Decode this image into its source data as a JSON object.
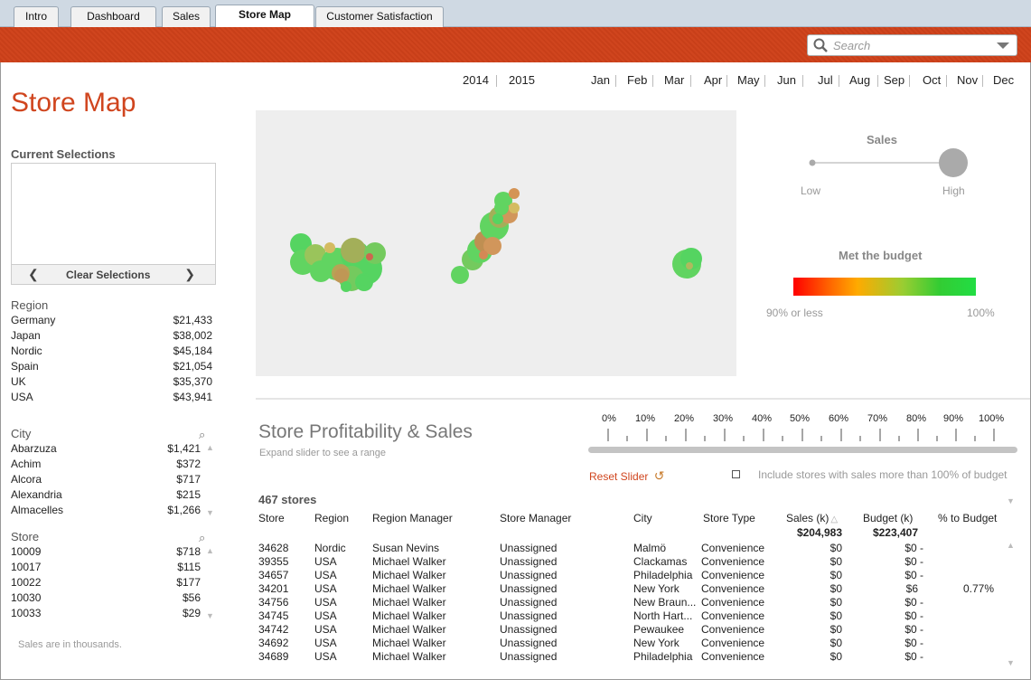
{
  "tabs": [
    {
      "label": "Intro"
    },
    {
      "label": "Dashboard"
    },
    {
      "label": "Sales"
    },
    {
      "label": "Store Map"
    },
    {
      "label": "Customer Satisfaction"
    }
  ],
  "search": {
    "placeholder": "Search"
  },
  "page": {
    "title": "Store Map"
  },
  "current_selections": {
    "title": "Current Selections",
    "clear_label": "Clear Selections"
  },
  "region": {
    "title": "Region",
    "items": [
      {
        "name": "Germany",
        "value": "$21,433"
      },
      {
        "name": "Japan",
        "value": "$38,002"
      },
      {
        "name": "Nordic",
        "value": "$45,184"
      },
      {
        "name": "Spain",
        "value": "$21,054"
      },
      {
        "name": "UK",
        "value": "$35,370"
      },
      {
        "name": "USA",
        "value": "$43,941"
      }
    ]
  },
  "city": {
    "title": "City",
    "items": [
      {
        "name": "Abarzuza",
        "value": "$1,421"
      },
      {
        "name": "Achim",
        "value": "$372"
      },
      {
        "name": "Alcora",
        "value": "$717"
      },
      {
        "name": "Alexandria",
        "value": "$215"
      },
      {
        "name": "Almacelles",
        "value": "$1,266"
      }
    ]
  },
  "store": {
    "title": "Store",
    "items": [
      {
        "name": "10009",
        "value": "$718"
      },
      {
        "name": "10017",
        "value": "$115"
      },
      {
        "name": "10022",
        "value": "$177"
      },
      {
        "name": "10030",
        "value": "$56"
      },
      {
        "name": "10033",
        "value": "$29"
      }
    ]
  },
  "note": "Sales are in thousands.",
  "years": [
    "2014",
    "2015"
  ],
  "months": [
    "Jan",
    "Feb",
    "Mar",
    "Apr",
    "May",
    "Jun",
    "Jul",
    "Aug",
    "Sep",
    "Oct",
    "Nov",
    "Dec"
  ],
  "legend": {
    "sales_title": "Sales",
    "low": "Low",
    "high": "High",
    "budget_title": "Met the budget",
    "budget_low": "90% or less",
    "budget_high": "100%",
    "gradient_colors": [
      "#ff0000",
      "#ffa500",
      "#9acd32",
      "#00c851",
      "#22dd44"
    ]
  },
  "profitability": {
    "title": "Store Profitability & Sales",
    "subtitle": "Expand slider to see a range",
    "percent_ticks": [
      "0%",
      "10%",
      "20%",
      "30%",
      "40%",
      "50%",
      "60%",
      "70%",
      "80%",
      "90%",
      "100%"
    ],
    "reset_label": "Reset Slider",
    "include_label": "Include stores with sales more than 100% of budget"
  },
  "table": {
    "count_label": "467 stores",
    "columns": [
      "Store",
      "Region",
      "Region Manager",
      "Store Manager",
      "City",
      "Store Type",
      "Sales (k)",
      "Budget (k)",
      "% to Budget"
    ],
    "total_sales": "$204,983",
    "total_budget": "$223,407",
    "rows": [
      {
        "store": "34628",
        "region": "Nordic",
        "rm": "Susan Nevins",
        "sm": "Unassigned",
        "city": "Malmö",
        "type": "Convenience",
        "sales": "$0",
        "budget": "$0 -",
        "pct": ""
      },
      {
        "store": "39355",
        "region": "USA",
        "rm": "Michael Walker",
        "sm": "Unassigned",
        "city": "Clackamas",
        "type": "Convenience",
        "sales": "$0",
        "budget": "$0 -",
        "pct": ""
      },
      {
        "store": "34657",
        "region": "USA",
        "rm": "Michael Walker",
        "sm": "Unassigned",
        "city": "Philadelphia",
        "type": "Convenience",
        "sales": "$0",
        "budget": "$0 -",
        "pct": ""
      },
      {
        "store": "34201",
        "region": "USA",
        "rm": "Michael Walker",
        "sm": "Unassigned",
        "city": "New York",
        "type": "Convenience",
        "sales": "$0",
        "budget": "$6",
        "pct": "0.77%"
      },
      {
        "store": "34756",
        "region": "USA",
        "rm": "Michael Walker",
        "sm": "Unassigned",
        "city": "New Braun...",
        "type": "Convenience",
        "sales": "$0",
        "budget": "$0 -",
        "pct": ""
      },
      {
        "store": "34745",
        "region": "USA",
        "rm": "Michael Walker",
        "sm": "Unassigned",
        "city": "North Hart...",
        "type": "Convenience",
        "sales": "$0",
        "budget": "$0 -",
        "pct": ""
      },
      {
        "store": "34742",
        "region": "USA",
        "rm": "Michael Walker",
        "sm": "Unassigned",
        "city": "Pewaukee",
        "type": "Convenience",
        "sales": "$0",
        "budget": "$0 -",
        "pct": ""
      },
      {
        "store": "34692",
        "region": "USA",
        "rm": "Michael Walker",
        "sm": "Unassigned",
        "city": "New York",
        "type": "Convenience",
        "sales": "$0",
        "budget": "$0 -",
        "pct": ""
      },
      {
        "store": "34689",
        "region": "USA",
        "rm": "Michael Walker",
        "sm": "Unassigned",
        "city": "Philadelphia",
        "type": "Convenience",
        "sales": "$0",
        "budget": "$0 -",
        "pct": ""
      }
    ]
  }
}
